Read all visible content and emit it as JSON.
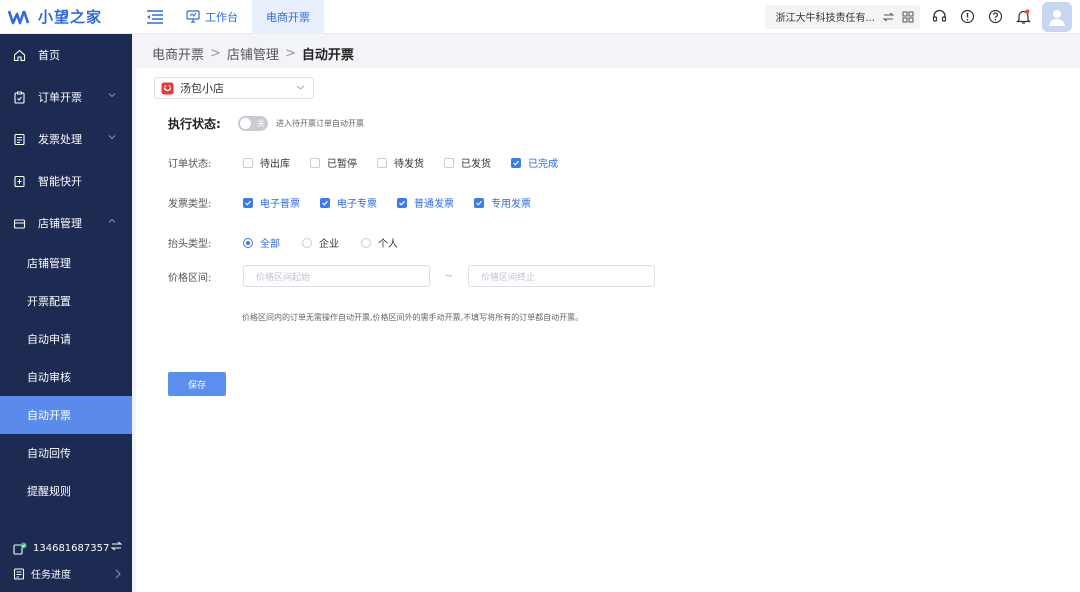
{
  "topbar": {
    "brand": "小望之家",
    "tabs": [
      {
        "label": "工作台",
        "active": false
      },
      {
        "label": "电商开票",
        "active": true
      }
    ],
    "company": "浙江大牛科技责任有...",
    "accent": "#2f6ae0"
  },
  "sidebar": {
    "menu": [
      {
        "label": "首页",
        "icon": "home-icon"
      },
      {
        "label": "订单开票",
        "icon": "clipboard-icon",
        "chevron": "down"
      },
      {
        "label": "发票处理",
        "icon": "invoice-icon",
        "chevron": "down"
      },
      {
        "label": "智能快开",
        "icon": "smart-invoice-icon"
      },
      {
        "label": "店铺管理",
        "icon": "store-icon",
        "chevron": "up"
      }
    ],
    "sub_items": [
      {
        "label": "店铺管理",
        "active": false
      },
      {
        "label": "开票配置",
        "active": false
      },
      {
        "label": "自动申请",
        "active": false
      },
      {
        "label": "自动审核",
        "active": false
      },
      {
        "label": "自动开票",
        "active": true
      },
      {
        "label": "自动回传",
        "active": false
      },
      {
        "label": "提醒规则",
        "active": false
      }
    ],
    "phone": "134681687357",
    "tasks": "任务进度"
  },
  "breadcrumb": [
    "电商开票",
    "店铺管理",
    "自动开票"
  ],
  "shop": {
    "name": "汤包小店"
  },
  "execution": {
    "label": "执行状态:",
    "toggle_text": "关",
    "hint": "进入待开票订单自动开票"
  },
  "order_status": {
    "label": "订单状态:",
    "options": [
      {
        "label": "待出库",
        "checked": false
      },
      {
        "label": "已暂停",
        "checked": false
      },
      {
        "label": "待发货",
        "checked": false
      },
      {
        "label": "已发货",
        "checked": false
      },
      {
        "label": "已完成",
        "checked": true
      }
    ]
  },
  "invoice_type": {
    "label": "发票类型:",
    "options": [
      {
        "label": "电子普票",
        "checked": true
      },
      {
        "label": "电子专票",
        "checked": true
      },
      {
        "label": "普通发票",
        "checked": true
      },
      {
        "label": "专用发票",
        "checked": true
      }
    ]
  },
  "title_type": {
    "label": "抬头类型:",
    "options": [
      {
        "label": "全部",
        "selected": true
      },
      {
        "label": "企业",
        "selected": false
      },
      {
        "label": "个人",
        "selected": false
      }
    ]
  },
  "price_range": {
    "label": "价格区间:",
    "start_placeholder": "价格区间起始",
    "end_placeholder": "价格区间终止",
    "separator": "~",
    "note": "价格区间内的订单无需操作自动开票,价格区间外的需手动开票,不填写将所有的订单都自动开票。"
  },
  "save_label": "保存"
}
